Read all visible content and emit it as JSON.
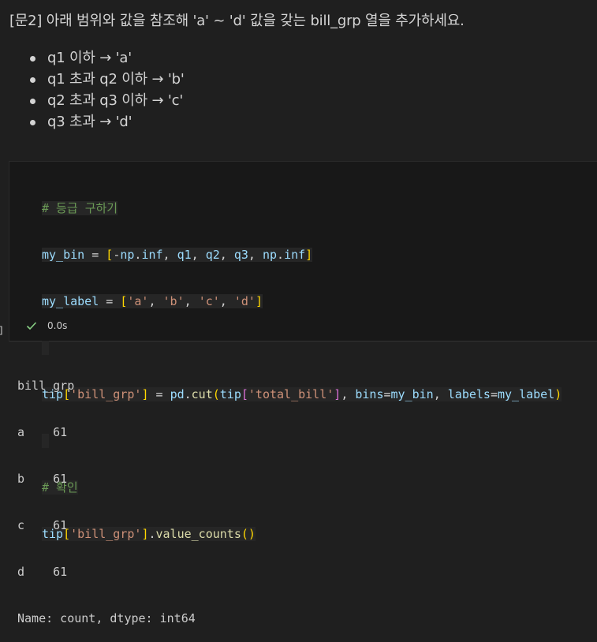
{
  "markdown": {
    "title": "[문2] 아래 범위와 값을 참조해 'a' ~ 'd' 값을 갖는 bill_grp 열을 추가하세요.",
    "bullets": [
      "q1 이하 → 'a'",
      "q1 초과 q2 이하 → 'b'",
      "q2 초과 q3 이하 → 'c'",
      "q3 초과 → 'd'"
    ]
  },
  "cell": {
    "code": {
      "comment1": "# 등급 구하기",
      "line2": {
        "var": "my_bin",
        "eq": " = ",
        "open": "[",
        "minus": "-",
        "np1": "np",
        "dot1": ".",
        "inf1": "inf",
        "c1": ", ",
        "q1": "q1",
        "c2": ", ",
        "q2": "q2",
        "c3": ", ",
        "q3": "q3",
        "c4": ", ",
        "np2": "np",
        "dot2": ".",
        "inf2": "inf",
        "close": "]"
      },
      "line3": {
        "var": "my_label",
        "eq": " = ",
        "open": "[",
        "a": "'a'",
        "c1": ", ",
        "b": "'b'",
        "c2": ", ",
        "c": "'c'",
        "c3": ", ",
        "d": "'d'",
        "close": "]"
      },
      "line5": {
        "tip": "tip",
        "o1": "[",
        "key": "'bill_grp'",
        "c1": "]",
        "eq": " = ",
        "pd": "pd",
        "dot": ".",
        "cut": "cut",
        "p1": "(",
        "tip2": "tip",
        "o2": "[",
        "key2": "'total_bill'",
        "c2": "]",
        "sep1": ", ",
        "bins": "bins",
        "eq2": "=",
        "mybin": "my_bin",
        "sep2": ", ",
        "labels": "labels",
        "eq3": "=",
        "mylabel": "my_label",
        "p2": ")"
      },
      "comment2": "# 확인",
      "line8": {
        "tip": "tip",
        "o1": "[",
        "key": "'bill_grp'",
        "c1": "]",
        "dot": ".",
        "fn": "value_counts",
        "paren": "()"
      }
    },
    "exec_time": "0.0s",
    "bracket": "]"
  },
  "output": {
    "lines": [
      "bill_grp",
      "a    61",
      "b    61",
      "c    61",
      "d    61",
      "Name: count, dtype: int64"
    ]
  },
  "colors": {
    "background": "#1f1f1f",
    "cell_background": "#181818",
    "comment": "#6a9955",
    "variable": "#9cdcfe",
    "string": "#ce9178",
    "function": "#dcdcaa",
    "bracket_gold": "#ffd700",
    "bracket_purple": "#da70d6",
    "success": "#89d185"
  },
  "icons": {
    "status": "check-icon",
    "bullet": "bullet-dot"
  }
}
